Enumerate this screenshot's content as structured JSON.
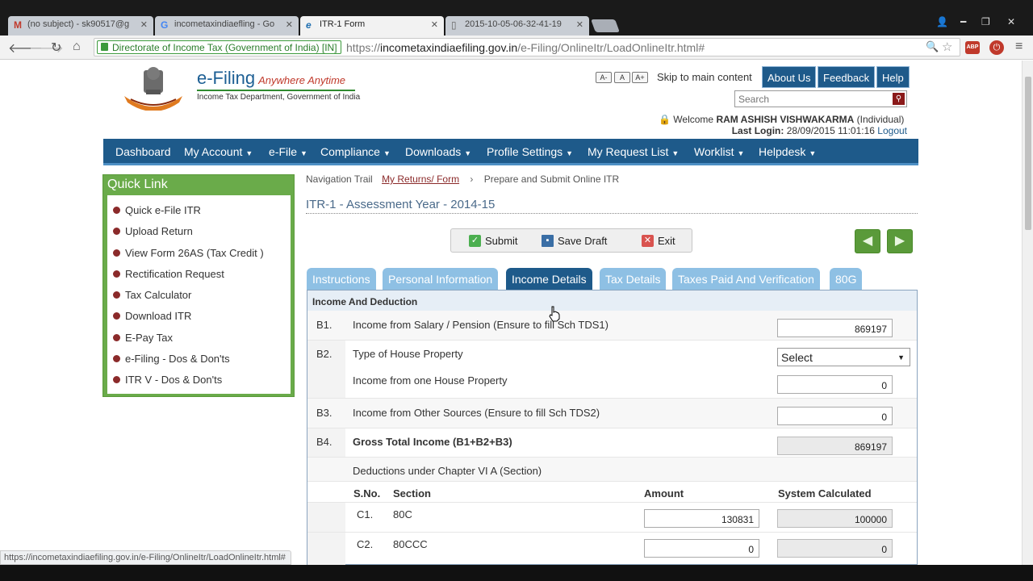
{
  "browser": {
    "tabs": [
      {
        "icon": "M",
        "title": "(no subject) - sk90517@g"
      },
      {
        "icon": "G",
        "title": "incometaxindiaefling - Go"
      },
      {
        "icon": "e",
        "title": "ITR-1 Form"
      },
      {
        "icon": "▯",
        "title": "2015-10-05-06-32-41-19"
      }
    ],
    "ev_cert": "Directorate of Income Tax (Government of India) [IN]",
    "url_scheme": "https://",
    "url_host": "incometaxindiaefiling.gov.in",
    "url_path": "/e-Filing/OnlineItr/LoadOnlineItr.html#",
    "status_url": "https://incometaxindiaefiling.gov.in/e-Filing/OnlineItr/LoadOnlineItr.html#"
  },
  "header": {
    "brand": "e-Filing",
    "tagline": "Anywhere Anytime",
    "dept": "Income Tax Department, Government of India",
    "font_small": "A-",
    "font_normal": "A",
    "font_large": "A+",
    "skip": "Skip to main content",
    "about": "About Us",
    "feedback": "Feedback",
    "help": "Help",
    "search_placeholder": "Search",
    "welcome_prefix": "Welcome",
    "user_name": "RAM ASHISH VISHWAKARMA",
    "user_type": "(Individual)",
    "last_login_label": "Last Login:",
    "last_login_value": "28/09/2015 11:01:16",
    "logout": "Logout"
  },
  "menu": [
    "Dashboard",
    "My Account",
    "e-File",
    "Compliance",
    "Downloads",
    "Profile Settings",
    "My Request List",
    "Worklist",
    "Helpdesk"
  ],
  "quick_link": {
    "title": "Quick Link",
    "items": [
      "Quick e-File ITR",
      "Upload Return",
      "View Form 26AS (Tax Credit )",
      "Rectification Request",
      "Tax Calculator",
      "Download ITR",
      "E-Pay Tax",
      "e-Filing - Dos & Don'ts",
      "ITR V - Dos & Don'ts"
    ]
  },
  "trail": {
    "label": "Navigation Trail",
    "link": "My Returns/ Form",
    "current": "Prepare and Submit Online ITR"
  },
  "page_title": "ITR-1 - Assessment Year - 2014-15",
  "actions": {
    "submit": "Submit",
    "save": "Save Draft",
    "exit": "Exit"
  },
  "form_tabs": [
    "Instructions",
    "Personal Information",
    "Income Details",
    "Tax Details",
    "Taxes Paid And Verification",
    "80G"
  ],
  "form": {
    "section": "Income And Deduction",
    "rows": {
      "b1": {
        "no": "B1.",
        "label": "Income from Salary / Pension (Ensure to fill Sch TDS1)",
        "value": "869197"
      },
      "b2": {
        "no": "B2.",
        "label": "Type of House Property",
        "select": "Select"
      },
      "b2b": {
        "label": "Income from one House Property",
        "value": "0"
      },
      "b3": {
        "no": "B3.",
        "label": "Income from Other Sources (Ensure to fill Sch TDS2)",
        "value": "0"
      },
      "b4": {
        "no": "B4.",
        "label": "Gross Total Income (B1+B2+B3)",
        "value": "869197"
      },
      "ded": {
        "label": "Deductions under Chapter VI A (Section)"
      }
    },
    "ded_headers": {
      "sno": "S.No.",
      "section": "Section",
      "amount": "Amount",
      "system": "System Calculated"
    },
    "c1": {
      "no": "C1.",
      "section": "80C",
      "amount": "130831",
      "system": "100000"
    },
    "c2": {
      "no": "C2.",
      "section": "80CCC",
      "amount": "0",
      "system": "0"
    }
  },
  "colors": {
    "primary": "#1e5a8a",
    "tab_light": "#8ec0e4",
    "quicklink": "#6aab4a"
  }
}
